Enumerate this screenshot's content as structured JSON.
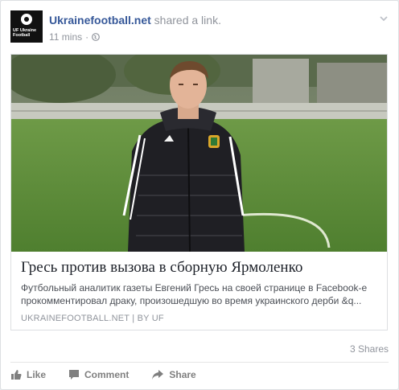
{
  "post": {
    "page_name": "Ukrainefootball.net",
    "action_text": " shared a link.",
    "time": "11 mins",
    "separator": "·",
    "avatar_text": "UF Ukraine Football"
  },
  "link": {
    "title": "Гресь против вызова в сборную Ярмоленко",
    "description": "Футбольный аналитик газеты Евгений Гресь на своей странице в Facebook-е прокомментировал драку, произошедшую во время украинского дерби &q...",
    "source": "UKRAINEFOOTBALL.NET | BY UF"
  },
  "stats": {
    "shares": "3 Shares"
  },
  "actions": {
    "like": "Like",
    "comment": "Comment",
    "share": "Share"
  },
  "colors": {
    "link_blue": "#365899",
    "meta_gray": "#90949c"
  }
}
